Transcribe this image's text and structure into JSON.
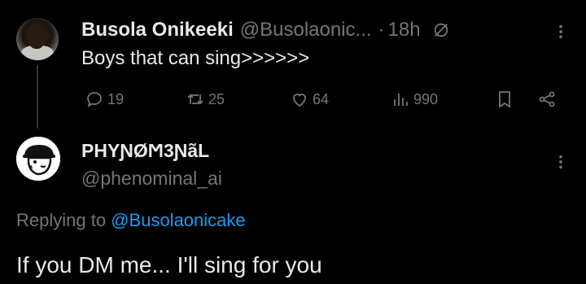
{
  "parent_tweet": {
    "author_name": "Busola Onikeeki",
    "author_handle": "@Busolaonic...",
    "separator": "·",
    "time": "18h",
    "text": "Boys that can sing>>>>>>",
    "replies": "19",
    "retweets": "25",
    "likes": "64",
    "views": "990"
  },
  "reply_tweet": {
    "author_name": "PHYƝØϺ3ƝãL",
    "author_handle": "@phenominal_ai",
    "replying_prefix": "Replying to",
    "replying_to": "@Busolaonicake",
    "text": "If you DM me... I'll sing for you"
  },
  "icons": {
    "reply": "reply-icon",
    "retweet": "retweet-icon",
    "like": "heart-icon",
    "views": "views-icon",
    "bookmark": "bookmark-icon",
    "share": "share-icon",
    "more": "more-icon",
    "no-slash": "grok-icon"
  },
  "colors": {
    "background": "#000000",
    "text": "#e7e9ea",
    "muted": "#71767b",
    "link": "#1d9bf0"
  }
}
